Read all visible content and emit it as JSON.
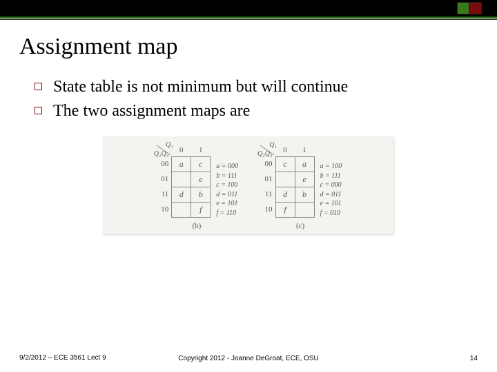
{
  "title": "Assignment map",
  "bullets": [
    "State table is not minimum but will continue",
    "The two assignment maps are"
  ],
  "footer": {
    "left": "9/2/2012 – ECE 3561 Lect 9",
    "center": "Copyright 2012 - Joanne DeGroat, ECE, OSU",
    "right": "14"
  },
  "maps": [
    {
      "caption": "(b)",
      "top_var": "Q₁",
      "side_var": "Q₂Q₃",
      "cols": [
        "0",
        "1"
      ],
      "rows": [
        "00",
        "01",
        "11",
        "10"
      ],
      "cells": [
        [
          "a",
          "c"
        ],
        [
          "",
          "e"
        ],
        [
          "d",
          "b"
        ],
        [
          "",
          "f"
        ]
      ],
      "assign": [
        "a = 000",
        "b = 111",
        "c = 100",
        "d = 011",
        "e = 101",
        "f = 110"
      ]
    },
    {
      "caption": "(c)",
      "top_var": "Q₁",
      "side_var": "Q₂Q₃",
      "cols": [
        "0",
        "1"
      ],
      "rows": [
        "00",
        "01",
        "11",
        "10"
      ],
      "cells": [
        [
          "c",
          "a"
        ],
        [
          "",
          "e"
        ],
        [
          "d",
          "b"
        ],
        [
          "f",
          ""
        ]
      ],
      "assign": [
        "a = 100",
        "b = 111",
        "c = 000",
        "d = 011",
        "e = 101",
        "f = 010"
      ]
    }
  ],
  "chart_data": [
    {
      "type": "table",
      "title": "Assignment map (b)",
      "row_labels": [
        "00",
        "01",
        "11",
        "10"
      ],
      "col_labels": [
        "0",
        "1"
      ],
      "cells": [
        [
          "a",
          "c"
        ],
        [
          "",
          "e"
        ],
        [
          "d",
          "b"
        ],
        [
          "",
          "f"
        ]
      ],
      "assignments": {
        "a": "000",
        "b": "111",
        "c": "100",
        "d": "011",
        "e": "101",
        "f": "110"
      }
    },
    {
      "type": "table",
      "title": "Assignment map (c)",
      "row_labels": [
        "00",
        "01",
        "11",
        "10"
      ],
      "col_labels": [
        "0",
        "1"
      ],
      "cells": [
        [
          "c",
          "a"
        ],
        [
          "",
          "e"
        ],
        [
          "d",
          "b"
        ],
        [
          "f",
          ""
        ]
      ],
      "assignments": {
        "a": "100",
        "b": "111",
        "c": "000",
        "d": "011",
        "e": "101",
        "f": "010"
      }
    }
  ]
}
